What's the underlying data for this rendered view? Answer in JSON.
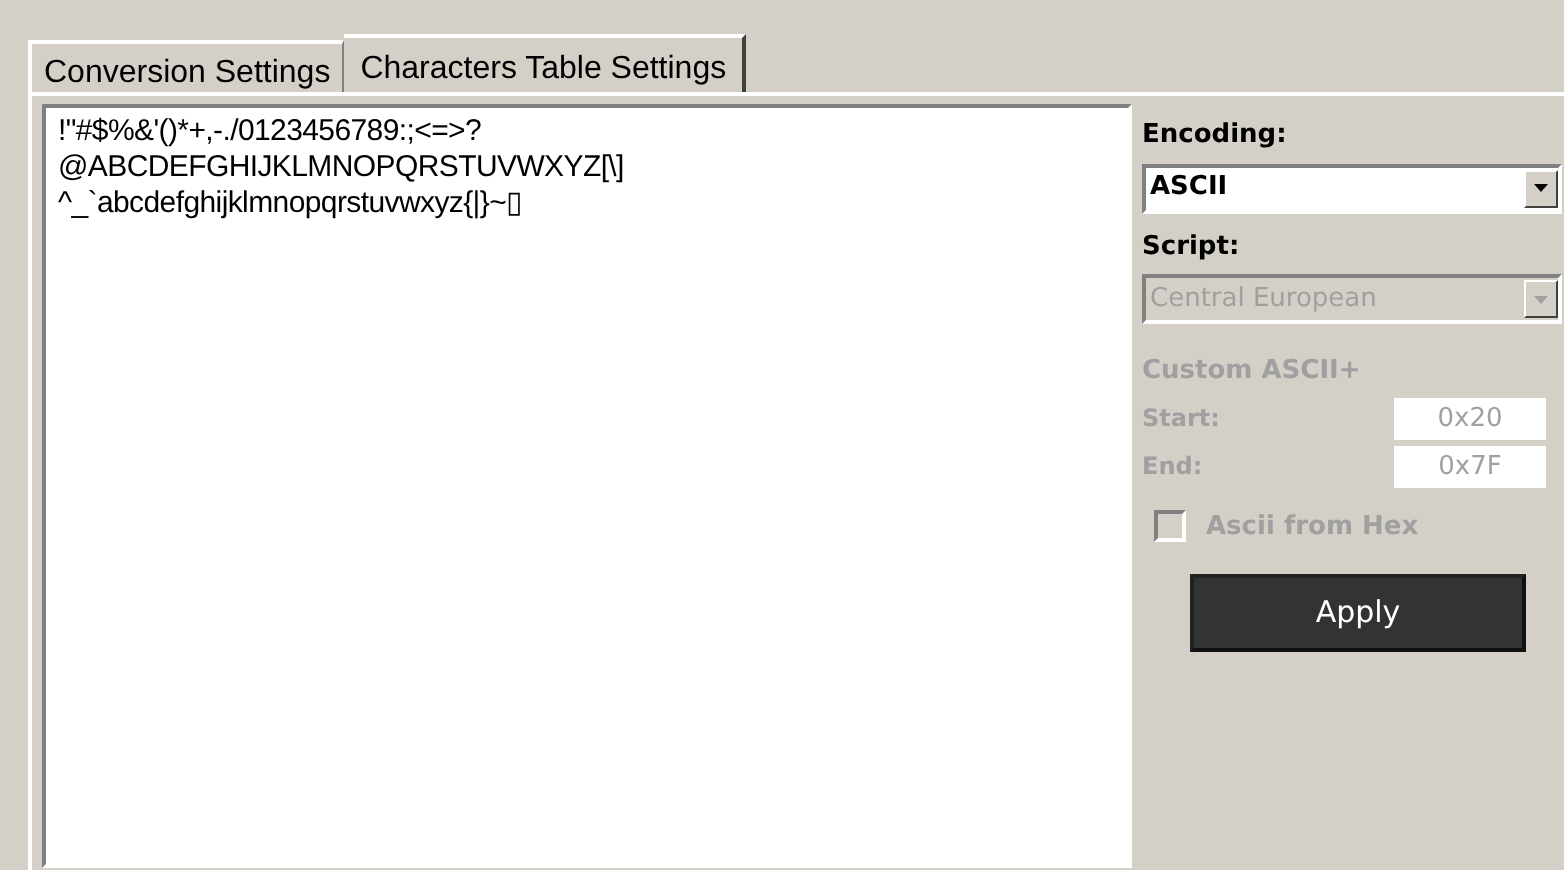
{
  "tabs": [
    {
      "label": "Conversion Settings",
      "selected": false
    },
    {
      "label": "Characters Table Settings",
      "selected": true
    }
  ],
  "characters": [
    "!\"#$%&'()*+,-./0123456789:;<=>?",
    "@ABCDEFGHIJKLMNOPQRSTUVWXYZ[\\]",
    "^_`abcdefghijklmnopqrstuvwxyz{|}~▯"
  ],
  "encoding": {
    "label": "Encoding:",
    "value": "ASCII",
    "disabled": false
  },
  "script": {
    "label": "Script:",
    "value": "Central European",
    "disabled": true
  },
  "custom": {
    "title": "Custom ASCII+",
    "disabled": true,
    "start": {
      "label": "Start:",
      "value": "0x20"
    },
    "end": {
      "label": "End:",
      "value": "0x7F"
    },
    "ascii_from_hex": {
      "label": "Ascii from Hex",
      "checked": false
    }
  },
  "apply": "Apply"
}
